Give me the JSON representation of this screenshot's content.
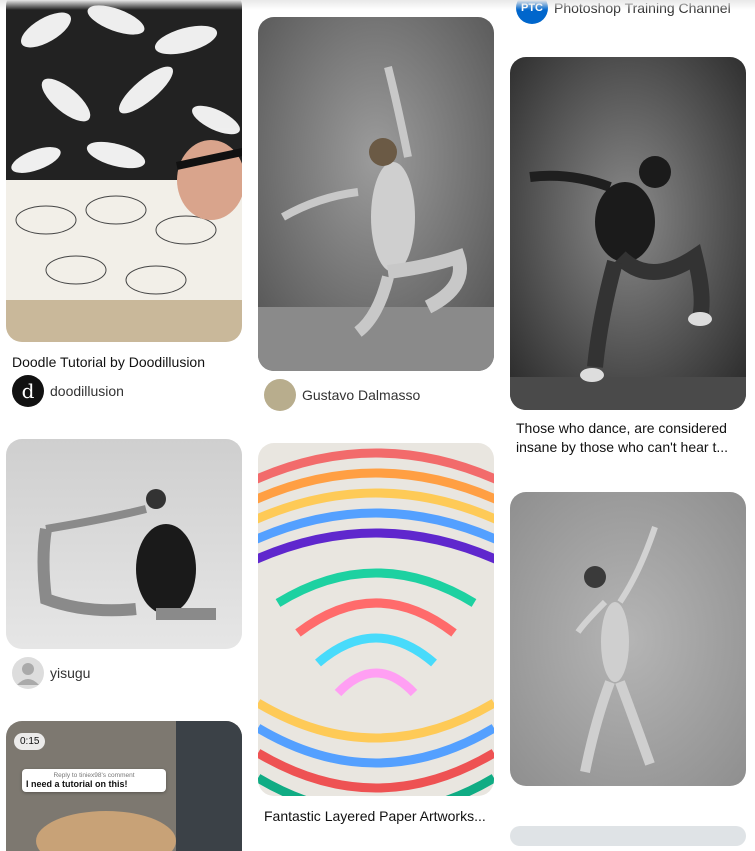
{
  "pins": [
    {
      "title": "Doodle Tutorial by Doodillusion",
      "author": "doodillusion",
      "avatar_letter": "d"
    },
    {
      "title": "",
      "author": "Gustavo Dalmasso"
    },
    {
      "title": "",
      "author": "Photoshop Training Channel",
      "avatar_letters": "PTC"
    },
    {
      "title": "Those who dance, are considered insane by those who can't hear t...",
      "author": ""
    },
    {
      "title": "",
      "author": "yisugu"
    },
    {
      "title": "Fantastic Layered Paper Artworks...",
      "author": ""
    },
    {
      "title": "",
      "author": ""
    },
    {
      "video": {
        "duration": "0:15",
        "reply_to": "Reply to tiniex98's comment",
        "comment": "I need a tutorial on this!"
      }
    }
  ],
  "colors": {
    "text": "#111111",
    "secondary": "#333333",
    "ptc_blue": "#0066cc"
  }
}
